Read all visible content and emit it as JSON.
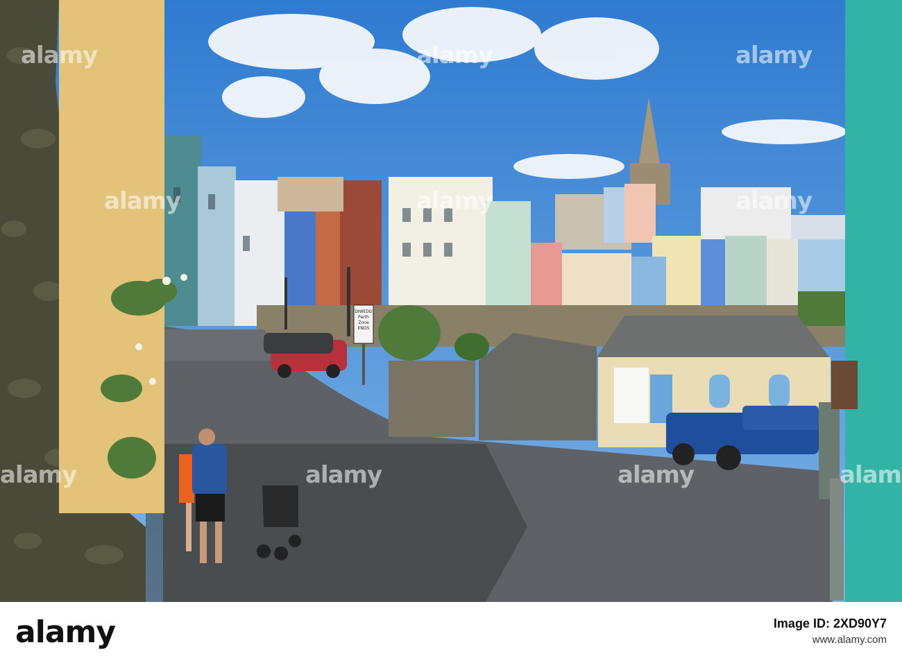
{
  "photo": {
    "watermarks": [
      "alamy",
      "alamy",
      "alamy",
      "alamy",
      "alamy",
      "alamy",
      "alamy",
      "alamy",
      "alamy",
      "alamy"
    ],
    "sign_text": [
      "DIWEDD",
      "Parth",
      "Zone",
      "ENDS"
    ]
  },
  "footer": {
    "logo": "alamy",
    "image_id_label": "Image ID: 2XD90Y7",
    "url": "www.alamy.com"
  },
  "colors": {
    "sky": "#3d86d6",
    "accent_blue_truck": "#1f4f9c"
  }
}
